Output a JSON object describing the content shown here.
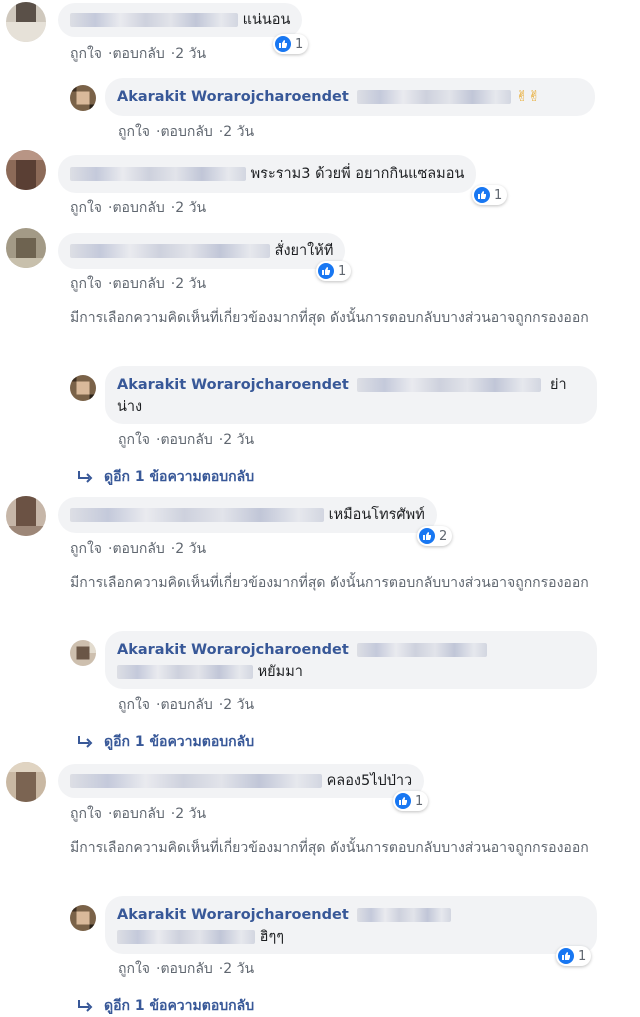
{
  "actions": {
    "like": "ถูกใจ",
    "reply": "ตอบกลับ",
    "sep": "·"
  },
  "note": "มีการเลือกความคิดเห็นที่เกี่ยวข้องมากที่สุด ดังนั้นการตอบกลับบางส่วนอาจถูกกรองออก",
  "view_more": "ดูอีก 1 ข้อความตอบกลับ",
  "author": "Akarakit Worarojcharoendet",
  "comments": [
    {
      "text": "แน่นอน",
      "time": "2 วัน",
      "likes": "1"
    },
    {
      "text": "✌✌",
      "time": "2 วัน"
    },
    {
      "text": "พระราม3 ด้วยพี่ อยากกินแซลมอน",
      "time": "2 วัน",
      "likes": "1"
    },
    {
      "text": "สั่งยาให้ที",
      "time": "2 วัน",
      "likes": "1"
    },
    {
      "text_line2": "น่าง",
      "text_end": "ย่า",
      "time": "2 วัน"
    },
    {
      "text": "เหมือนโทรศัพท์",
      "time": "2 วัน",
      "likes": "2"
    },
    {
      "text": "หยัมมา",
      "time": "2 วัน"
    },
    {
      "text": "คลอง5ไปป่าว",
      "time": "2 วัน",
      "likes": "1"
    },
    {
      "text": "ฮิๆๆ",
      "time": "2 วัน",
      "likes": "1"
    }
  ],
  "colors": {
    "name": "#385898",
    "bubble": "#f2f3f5",
    "meta": "#606770",
    "like": "#1877f2"
  }
}
